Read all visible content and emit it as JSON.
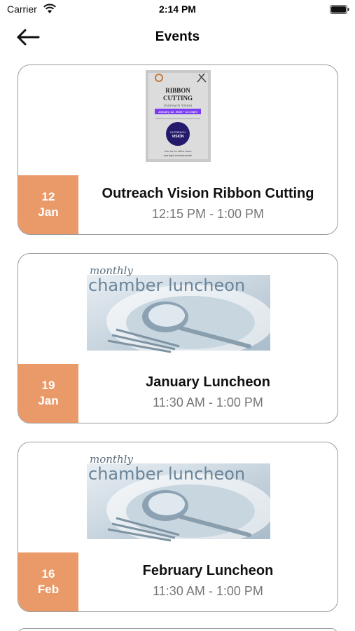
{
  "status_bar": {
    "carrier": "Carrier",
    "time": "2:14 PM"
  },
  "nav": {
    "title": "Events",
    "back_icon": "arrow-left-icon"
  },
  "events": [
    {
      "day": "12",
      "month": "Jan",
      "title": "Outreach Vision Ribbon Cutting",
      "time": "12:15 PM - 1:00 PM",
      "flyer": {
        "heading1": "RIBBON",
        "heading2": "CUTTING",
        "script": "Outreach Vision",
        "date_line": "January 12, 2024 • 12:15pm",
        "logo_line1": "OUTREACH",
        "logo_line2": "VISION",
        "footer1": "Join us for office tours",
        "footer2": "and light refreshments!"
      }
    },
    {
      "day": "19",
      "month": "Jan",
      "title": "January Luncheon",
      "time": "11:30 AM - 1:00 PM",
      "banner": {
        "script": "monthly",
        "heading": "chamber luncheon"
      }
    },
    {
      "day": "16",
      "month": "Feb",
      "title": "February Luncheon",
      "time": "11:30 AM - 1:00 PM",
      "banner": {
        "script": "monthly",
        "heading": "chamber luncheon"
      }
    }
  ],
  "colors": {
    "badge": "#e99a68",
    "time_text": "#777777",
    "card_border": "#9a9a9a"
  }
}
